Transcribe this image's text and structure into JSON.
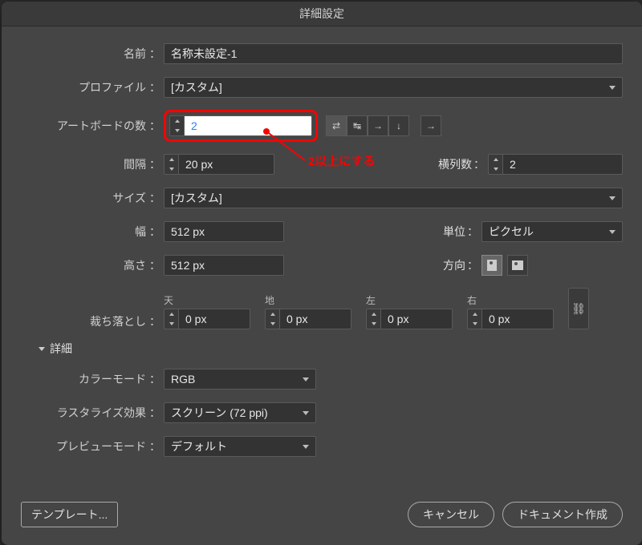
{
  "window": {
    "title": "詳細設定"
  },
  "labels": {
    "name": "名前",
    "profile": "プロファイル",
    "artboards": "アートボードの数",
    "spacing": "間隔",
    "columns": "横列数",
    "size": "サイズ",
    "width": "幅",
    "height": "高さ",
    "unit": "単位",
    "orientation": "方向",
    "bleed": "裁ち落とし",
    "bleed_top": "天",
    "bleed_bottom": "地",
    "bleed_left": "左",
    "bleed_right": "右",
    "advanced": "詳細",
    "color_mode": "カラーモード",
    "raster": "ラスタライズ効果",
    "preview": "プレビューモード"
  },
  "values": {
    "name": "名称未設定-1",
    "profile": "[カスタム]",
    "artboards": "2",
    "spacing": "20 px",
    "columns": "2",
    "size": "[カスタム]",
    "width": "512 px",
    "height": "512 px",
    "unit": "ピクセル",
    "bleed_top": "0 px",
    "bleed_bottom": "0 px",
    "bleed_left": "0 px",
    "bleed_right": "0 px",
    "color_mode": "RGB",
    "raster": "スクリーン (72 ppi)",
    "preview": "デフォルト"
  },
  "icons": {
    "grid_z": "⇄",
    "arr_lr": "↹",
    "arr_r": "→",
    "arr_d": "↓",
    "arr_r2": "→",
    "link": "⛓"
  },
  "annotation": {
    "text": "2以上にする"
  },
  "buttons": {
    "template": "テンプレート...",
    "cancel": "キャンセル",
    "create": "ドキュメント作成"
  }
}
